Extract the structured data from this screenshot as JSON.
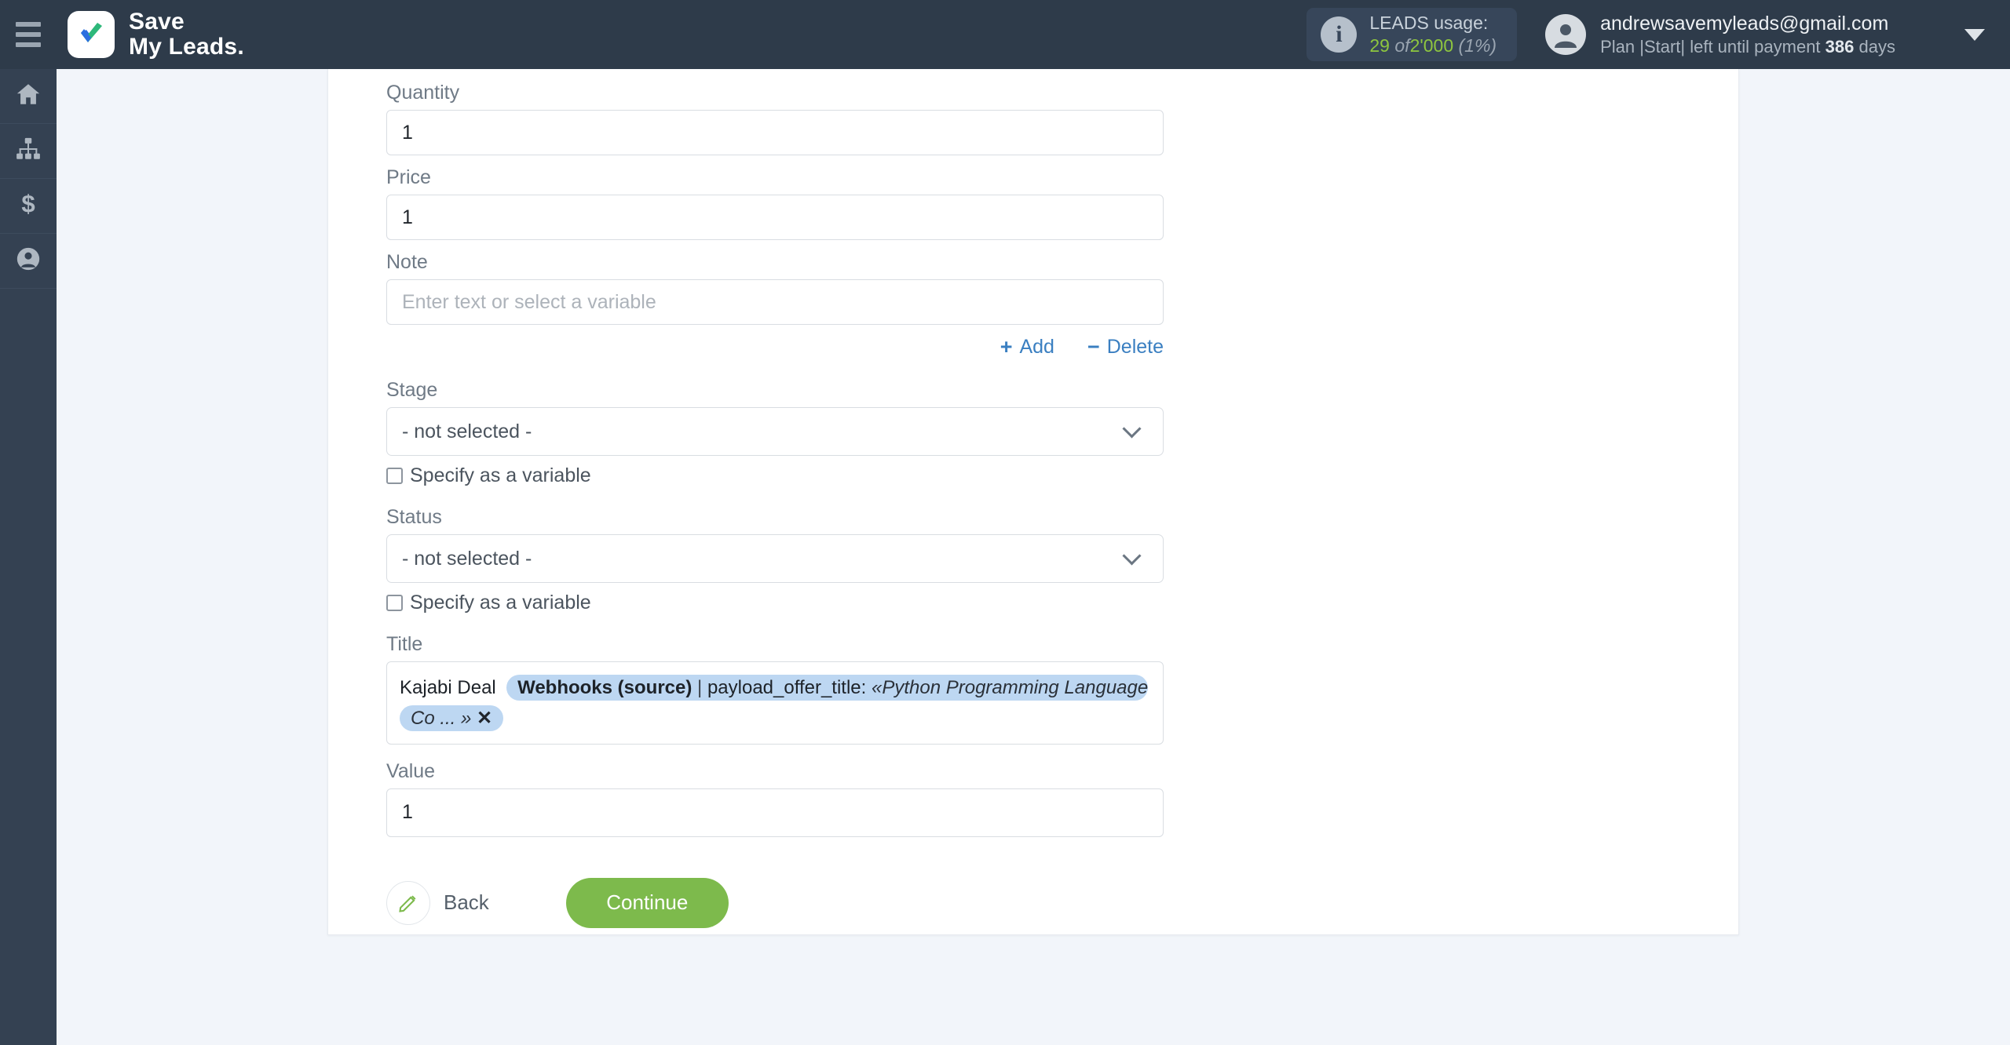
{
  "brand": {
    "line1": "Save",
    "line2": "My Leads.",
    "logo_icon": "checkmark-logo"
  },
  "header": {
    "menu_icon": "hamburger-menu-icon",
    "usage": {
      "info_icon": "info-icon",
      "title": "LEADS usage:",
      "used": "29",
      "of": "of",
      "total": "2'000",
      "percent": "(1%)"
    },
    "account": {
      "avatar_icon": "user-avatar-icon",
      "email": "andrewsavemyleads@gmail.com",
      "plan_prefix": "Plan |Start| left until payment",
      "plan_days": "386",
      "plan_suffix": "days",
      "caret_icon": "chevron-down-icon"
    }
  },
  "sidebar": {
    "items": [
      {
        "icon": "home-icon",
        "label": "Home"
      },
      {
        "icon": "connections-icon",
        "label": "Connections"
      },
      {
        "icon": "dollar-icon",
        "label": "Billing"
      },
      {
        "icon": "user-icon",
        "label": "Account"
      }
    ]
  },
  "form": {
    "quantity": {
      "label": "Quantity",
      "value": "1"
    },
    "price": {
      "label": "Price",
      "value": "1"
    },
    "note": {
      "label": "Note",
      "value": "",
      "placeholder": "Enter text or select a variable"
    },
    "add_label": "Add",
    "add_glyph": "+",
    "delete_label": "Delete",
    "delete_glyph": "−",
    "stage": {
      "label": "Stage",
      "selected": "- not selected -",
      "checkbox_label": "Specify as a variable",
      "checked": false
    },
    "status": {
      "label": "Status",
      "selected": "- not selected -",
      "checkbox_label": "Specify as a variable",
      "checked": false
    },
    "title": {
      "label": "Title",
      "static_text": "Kajabi Deal",
      "chip": {
        "source": "Webhooks (source)",
        "separator": "|",
        "field": "payload_offer_title:",
        "value": "«Python Programming Language Co ... »",
        "remove_glyph": "✕"
      }
    },
    "value": {
      "label": "Value",
      "value": "1"
    },
    "back_label": "Back",
    "back_icon": "pencil-icon",
    "continue_label": "Continue"
  },
  "colors": {
    "header_bg": "#2e3b4a",
    "sidebar_bg": "#344152",
    "page_bg": "#f2f5fa",
    "accent_green": "#7dba4c",
    "usage_green": "#8ec63f",
    "link_blue": "#3a7fc1",
    "chip_blue": "#bdd7f2"
  }
}
